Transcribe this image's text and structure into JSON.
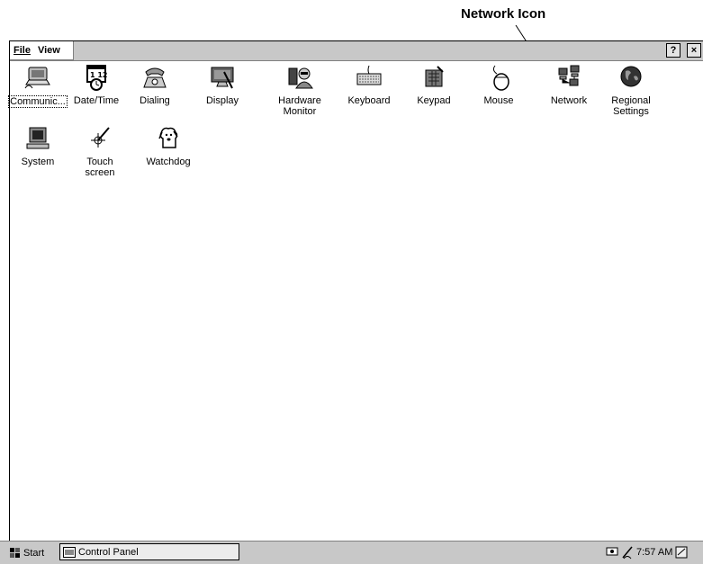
{
  "annotation": {
    "label": "Network Icon"
  },
  "menu": {
    "file": "File",
    "view": "View"
  },
  "title_buttons": {
    "help": "?",
    "close": "×"
  },
  "icons": [
    {
      "label": "Communic...",
      "icon": "communication-icon"
    },
    {
      "label": "Date/Time",
      "icon": "calendar-clock-icon"
    },
    {
      "label": "Dialing",
      "icon": "telephone-icon"
    },
    {
      "label": "Display",
      "icon": "display-monitor-icon"
    },
    {
      "label": "Hardware\nMonitor",
      "icon": "hardware-monitor-icon"
    },
    {
      "label": "Keyboard",
      "icon": "keyboard-icon"
    },
    {
      "label": "Keypad",
      "icon": "keypad-icon"
    },
    {
      "label": "Mouse",
      "icon": "mouse-icon"
    },
    {
      "label": "Network",
      "icon": "network-computers-icon"
    },
    {
      "label": "Regional\nSettings",
      "icon": "globe-icon"
    },
    {
      "label": "System",
      "icon": "system-computer-icon"
    },
    {
      "label": "Touch\nscreen",
      "icon": "stylus-crosshair-icon"
    },
    {
      "label": "Watchdog",
      "icon": "dog-icon"
    }
  ],
  "taskbar": {
    "start_label": "Start",
    "task_label": "Control Panel",
    "clock": "7:57 AM"
  }
}
